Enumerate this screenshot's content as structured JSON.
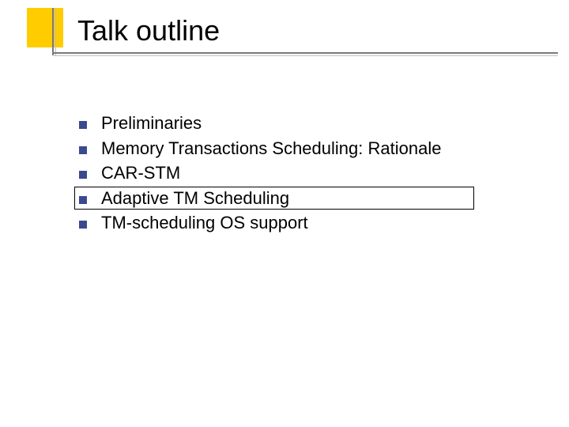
{
  "title": "Talk outline",
  "bullets": [
    {
      "text": "Preliminaries"
    },
    {
      "text": "Memory Transactions Scheduling: Rationale"
    },
    {
      "text": "CAR-STM"
    },
    {
      "text": "Adaptive TM Scheduling",
      "highlighted": true
    },
    {
      "text": "TM-scheduling OS support"
    }
  ],
  "colors": {
    "accent_yellow": "#ffcc00",
    "bullet_square": "#3a4a8f",
    "rule_dark": "#7a7a7a",
    "rule_light": "#bfbfbf"
  }
}
